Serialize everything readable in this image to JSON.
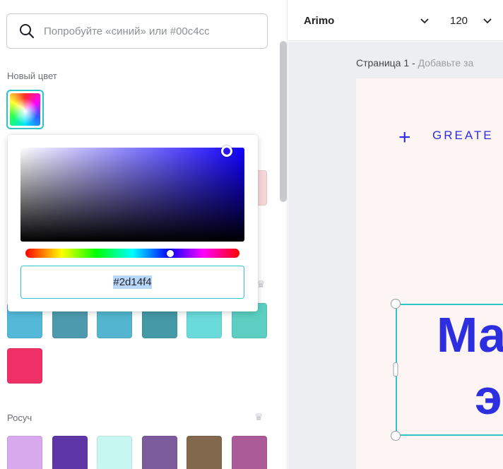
{
  "search": {
    "placeholder": "Попробуйте «синий» или #00c4cc"
  },
  "new_color": {
    "title": "Новый цвет"
  },
  "picker": {
    "hex_value": "#2d14f4",
    "hue_position": 0.678,
    "saturation": 0.92,
    "brightness": 0.96
  },
  "swatch_rows": [
    {
      "colors": [
        "#54b9d9",
        "#4d9aae",
        "#53b5cf",
        "#4499a7",
        "#6adbdb",
        "#5ccfc2"
      ]
    },
    {
      "colors": [
        "#ee3067"
      ]
    }
  ],
  "partial_swatch": {
    "color": "#f6d6d6"
  },
  "section_rosuch": {
    "title": "Росуч",
    "colors": [
      "#d8a9ec",
      "#5f36a8",
      "#c6f7f1",
      "#7c5b9c",
      "#82684d",
      "#ab5b97"
    ]
  },
  "editor": {
    "font_name": "Arimo",
    "font_size": "120",
    "page_label": "Страница 1 -",
    "page_hint": "Добавьте за",
    "heading_small": "GREATE",
    "big_line1": "Ма",
    "big_line2": "э"
  }
}
